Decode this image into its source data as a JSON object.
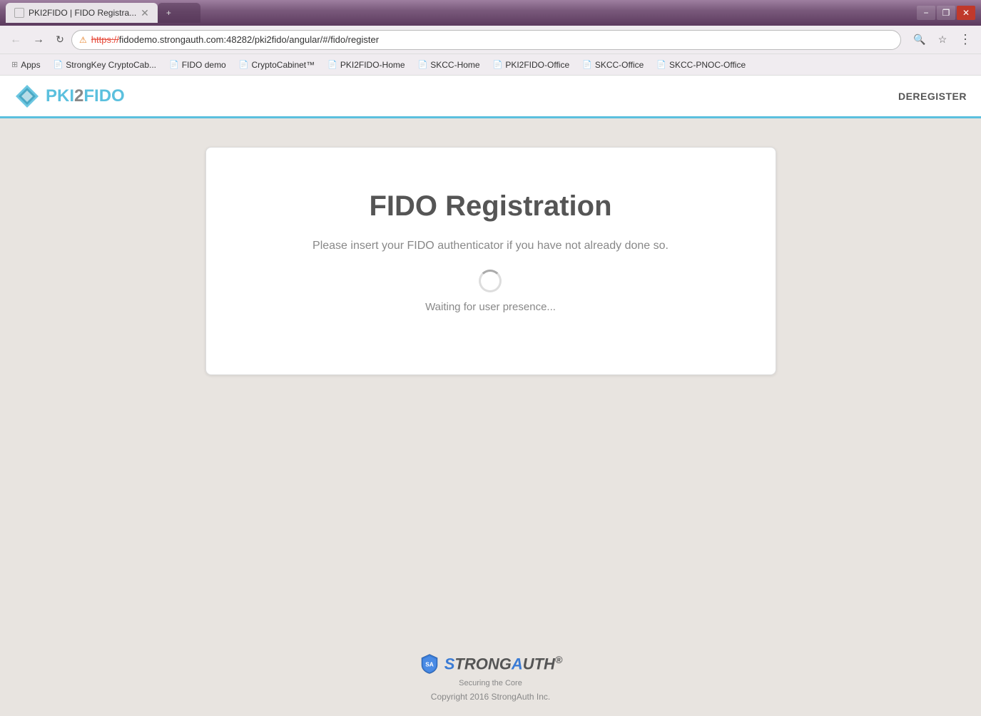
{
  "window": {
    "title": "PKI2FIDO | FIDO Registra...",
    "inactive_tab": "+"
  },
  "titlebar": {
    "tab_title": "PKI2FIDO | FIDO Registra...",
    "minimize_label": "−",
    "restore_label": "❐",
    "close_label": "✕"
  },
  "navbar": {
    "back_label": "←",
    "forward_label": "→",
    "refresh_label": "↻",
    "url": "https://fidodemo.strongauth.com:48282/pki2fido/angular/#/fido/register",
    "url_prefix": "https://",
    "url_body": "fidodemo.strongauth.com:48282/pki2fido/angular/#/fido/register",
    "search_icon": "🔍",
    "star_icon": "☆",
    "menu_icon": "⋮"
  },
  "bookmarks": {
    "items": [
      {
        "label": "Apps",
        "icon": "⊞"
      },
      {
        "label": "StrongKey CryptoCab...",
        "icon": "📄"
      },
      {
        "label": "FIDO demo",
        "icon": "📄"
      },
      {
        "label": "CryptoCabinet™",
        "icon": "📄"
      },
      {
        "label": "PKI2FIDO-Home",
        "icon": "📄"
      },
      {
        "label": "SKCC-Home",
        "icon": "📄"
      },
      {
        "label": "PKI2FIDO-Office",
        "icon": "📄"
      },
      {
        "label": "SKCC-Office",
        "icon": "📄"
      },
      {
        "label": "SKCC-PNOC-Office",
        "icon": "📄"
      }
    ]
  },
  "app_header": {
    "logo_text": "PKI2FIDO",
    "nav_items": [
      {
        "label": "DEREGISTER"
      }
    ]
  },
  "registration": {
    "title": "FIDO Registration",
    "subtitle": "Please insert your FIDO authenticator if you have not already done so.",
    "waiting_text": "Waiting for user presence..."
  },
  "footer": {
    "brand_text": "StrongAuth",
    "brand_suffix": "®",
    "tagline": "Securing the Core",
    "copyright": "Copyright 2016 StrongAuth Inc."
  }
}
